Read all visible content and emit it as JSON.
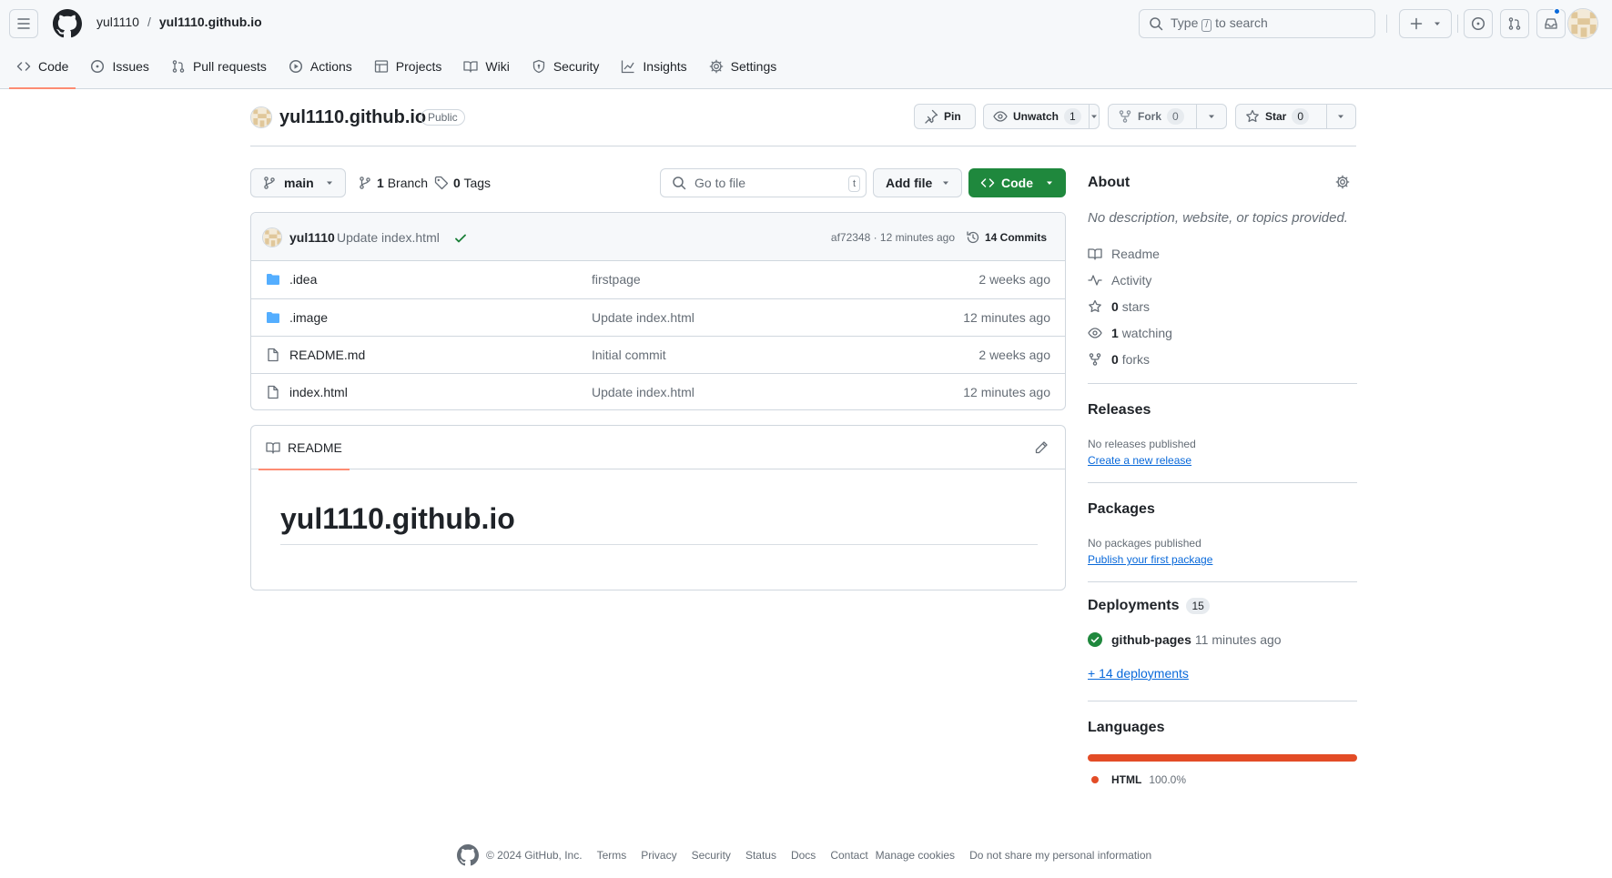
{
  "header": {
    "owner": "yul1110",
    "separator": "/",
    "repo": "yul1110.github.io",
    "search": {
      "prefix": "Type",
      "key": "/",
      "suffix": "to search"
    }
  },
  "repo_nav": [
    {
      "label": "Code",
      "icon": "code-icon",
      "active": true
    },
    {
      "label": "Issues",
      "icon": "issue-icon"
    },
    {
      "label": "Pull requests",
      "icon": "pull-request-icon"
    },
    {
      "label": "Actions",
      "icon": "play-icon"
    },
    {
      "label": "Projects",
      "icon": "table-icon"
    },
    {
      "label": "Wiki",
      "icon": "book-icon"
    },
    {
      "label": "Security",
      "icon": "shield-icon"
    },
    {
      "label": "Insights",
      "icon": "graph-icon"
    },
    {
      "label": "Settings",
      "icon": "gear-icon"
    }
  ],
  "repo_head": {
    "name": "yul1110.github.io",
    "visibility": "Public",
    "pin": "Pin",
    "unwatch": "Unwatch",
    "watch_count": "1",
    "fork": "Fork",
    "fork_count": "0",
    "star": "Star",
    "star_count": "0"
  },
  "toolbar": {
    "branch": "main",
    "branches_count": "1",
    "branches_label": "Branch",
    "tags_count": "0",
    "tags_label": "Tags",
    "go_to_file": "Go to file",
    "go_to_file_key": "t",
    "add_file": "Add file",
    "code": "Code"
  },
  "latest_commit": {
    "author": "yul1110",
    "message": "Update index.html",
    "sha_time": "af72348 · 12 minutes ago",
    "commits": "14 Commits"
  },
  "files": [
    {
      "name": ".idea",
      "type": "folder",
      "message": "firstpage",
      "date": "2 weeks ago"
    },
    {
      "name": ".image",
      "type": "folder",
      "message": "Update index.html",
      "date": "12 minutes ago"
    },
    {
      "name": "README.md",
      "type": "file",
      "message": "Initial commit",
      "date": "2 weeks ago"
    },
    {
      "name": "index.html",
      "type": "file",
      "message": "Update index.html",
      "date": "12 minutes ago"
    }
  ],
  "readme": {
    "tab": "README",
    "heading": "yul1110.github.io"
  },
  "about": {
    "title": "About",
    "description": "No description, website, or topics provided.",
    "readme": "Readme",
    "activity": "Activity",
    "stars_count": "0",
    "stars_label": "stars",
    "watching_count": "1",
    "watching_label": "watching",
    "forks_count": "0",
    "forks_label": "forks"
  },
  "releases": {
    "title": "Releases",
    "empty": "No releases published",
    "link": "Create a new release"
  },
  "packages": {
    "title": "Packages",
    "empty": "No packages published",
    "link": "Publish your first package"
  },
  "deployments": {
    "title": "Deployments",
    "count": "15",
    "env": "github-pages",
    "time": "11 minutes ago",
    "more": "+ 14 deployments"
  },
  "languages": {
    "title": "Languages",
    "name": "HTML",
    "percent": "100.0%",
    "fraction": 1.0,
    "color": "#e34c26"
  },
  "footer": {
    "copyright": "© 2024 GitHub, Inc.",
    "links": [
      "Terms",
      "Privacy",
      "Security",
      "Status",
      "Docs",
      "Contact",
      "Manage cookies",
      "Do not share my personal information"
    ]
  },
  "colors": {
    "accent_underline": "#fd8c73",
    "primary_green": "#1f883d",
    "link_blue": "#0969da",
    "folder_blue": "#54aeff"
  }
}
